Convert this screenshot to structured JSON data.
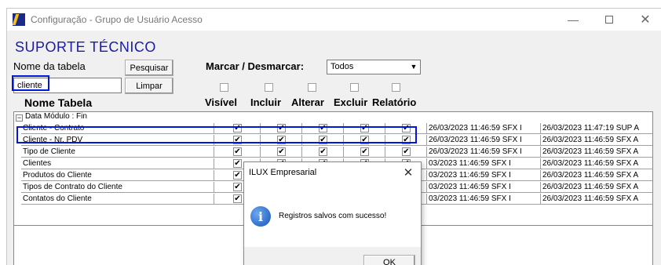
{
  "window": {
    "title": "Configuração - Grupo de Usuário Acesso",
    "minimize": "—",
    "maximize": "",
    "close": "✕"
  },
  "form": {
    "title": "SUPORTE TÉCNICO",
    "table_name_label": "Nome da tabela",
    "search_button": "Pesquisar",
    "clear_button": "Limpar",
    "search_value": "cliente",
    "mark_label": "Marcar / Desmarcar:",
    "filter_value": "Todos"
  },
  "columns": {
    "table": "Nome Tabela",
    "visible": "Visível",
    "include": "Incluir",
    "alter": "Alterar",
    "delete": "Excluir",
    "report": "Relatório"
  },
  "grid": {
    "group_toggle": "−",
    "group_label": "Data Módulo : Fin",
    "rows": [
      {
        "name": "Cliente - Contrato",
        "created": "26/03/2023 11:46:59 SFX I",
        "updated": "26/03/2023 11:47:19 SUP A"
      },
      {
        "name": "Cliente - Nr. PDV",
        "created": "26/03/2023 11:46:59 SFX I",
        "updated": "26/03/2023 11:46:59 SFX A"
      },
      {
        "name": "Tipo de Cliente",
        "created": "26/03/2023 11:46:59 SFX I",
        "updated": "26/03/2023 11:46:59 SFX A"
      },
      {
        "name": "Clientes",
        "created": "03/2023 11:46:59 SFX I",
        "updated": "26/03/2023 11:46:59 SFX A"
      },
      {
        "name": "Produtos do Cliente",
        "created": "03/2023 11:46:59 SFX I",
        "updated": "26/03/2023 11:46:59 SFX A"
      },
      {
        "name": "Tipos de Contrato do Cliente",
        "created": "03/2023 11:46:59 SFX I",
        "updated": "26/03/2023 11:46:59 SFX A"
      },
      {
        "name": "Contatos do Cliente",
        "created": "03/2023 11:46:59 SFX I",
        "updated": "26/03/2023 11:46:59 SFX A"
      }
    ],
    "check_mark": "✔"
  },
  "dialog": {
    "title": "ILUX Empresarial",
    "close": "✕",
    "icon": "i",
    "message": "Registros salvos com sucesso!",
    "ok": "OK"
  },
  "colors": {
    "accent_blue": "#1a1aa6",
    "highlight_box": "#0018d8"
  },
  "icons": [
    "app-icon",
    "info-icon",
    "check-icon",
    "chevron-down-icon",
    "close-icon"
  ]
}
